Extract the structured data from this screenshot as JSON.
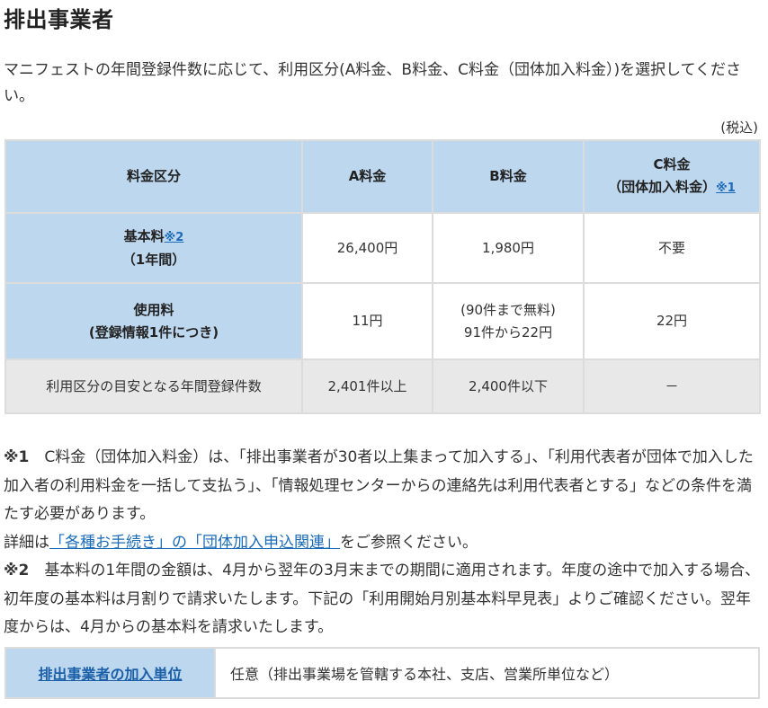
{
  "title": "排出事業者",
  "intro": "マニフェストの年間登録件数に応じて、利用区分(A料金、B料金、C料金（団体加入料金）)を選択してください。",
  "tax_note": "(税込)",
  "table": {
    "header": {
      "category": "料金区分",
      "a": "A料金",
      "b": "B料金",
      "c_line1": "C料金",
      "c_line2": "（団体加入料金）",
      "c_note_link": "※1"
    },
    "rows": {
      "basic": {
        "label_line1": "基本料",
        "label_note_link": "※2",
        "label_line2": "（1年間）",
        "a": "26,400円",
        "b": "1,980円",
        "c": "不要"
      },
      "usage": {
        "label_line1": "使用料",
        "label_line2": "(登録情報1件につき)",
        "a": "11円",
        "b_line1": "(90件まで無料)",
        "b_line2": "91件から22円",
        "c": "22円"
      },
      "guide": {
        "label": "利用区分の目安となる年間登録件数",
        "a": "2,401件以上",
        "b": "2,400件以下",
        "c": "－"
      }
    }
  },
  "notes": {
    "n1_mark": "※1",
    "n1_text": "　C料金（団体加入料金）は、「排出事業者が30者以上集まって加入する」、「利用代表者が団体で加入した加入者の利用料金を一括して支払う」、「情報処理センターからの連絡先は利用代表者とする」などの条件を満たす必要があります。",
    "detail_prefix": "詳細は",
    "detail_link": "「各種お手続き」の「団体加入申込関連」",
    "detail_suffix": "をご参照ください。",
    "n2_mark": "※2",
    "n2_text": "　基本料の1年間の金額は、4月から翌年の3月末までの期間に適用されます。年度の途中で加入する場合、初年度の基本料は月割りで請求いたします。下記の「利用開始月別基本料早見表」よりご確認ください。翌年度からは、4月からの基本料を請求いたします。"
  },
  "unit": {
    "label_link": "排出事業者の加入単位",
    "value": "任意（排出事業場を管轄する本社、支店、営業所単位など）"
  }
}
